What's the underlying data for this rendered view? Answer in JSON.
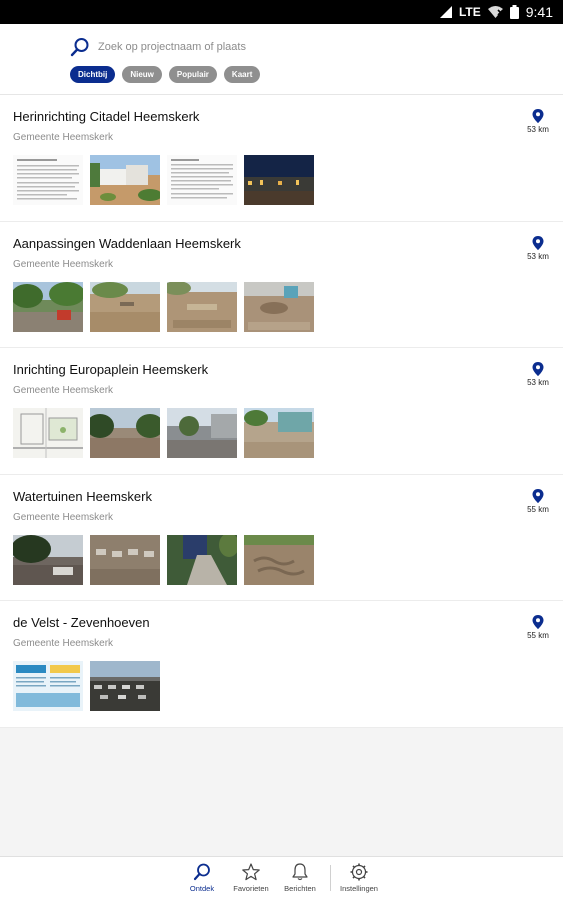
{
  "status_bar": {
    "network": "LTE",
    "time": "9:41"
  },
  "search": {
    "placeholder": "Zoek op projectnaam of plaats"
  },
  "filters": [
    {
      "label": "Dichtbij",
      "active": true
    },
    {
      "label": "Nieuw",
      "active": false
    },
    {
      "label": "Populair",
      "active": false
    },
    {
      "label": "Kaart",
      "active": false
    }
  ],
  "projects": [
    {
      "title": "Herinrichting Citadel Heemskerk",
      "subtitle": "Gemeente Heemskerk",
      "distance": "53 km",
      "thumbnails": [
        "document-thumbnail",
        "photo-thumbnail",
        "document-thumbnail",
        "photo-thumbnail"
      ]
    },
    {
      "title": "Aanpassingen Waddenlaan Heemskerk",
      "subtitle": "Gemeente Heemskerk",
      "distance": "53 km",
      "thumbnails": [
        "photo-thumbnail",
        "photo-thumbnail",
        "photo-thumbnail",
        "photo-thumbnail"
      ]
    },
    {
      "title": "Inrichting Europaplein Heemskerk",
      "subtitle": "Gemeente Heemskerk",
      "distance": "53 km",
      "thumbnails": [
        "map-thumbnail",
        "photo-thumbnail",
        "photo-thumbnail",
        "photo-thumbnail"
      ]
    },
    {
      "title": "Watertuinen Heemskerk",
      "subtitle": "Gemeente Heemskerk",
      "distance": "55 km",
      "thumbnails": [
        "photo-thumbnail",
        "photo-thumbnail",
        "photo-thumbnail",
        "photo-thumbnail"
      ]
    },
    {
      "title": "de Velst - Zevenhoeven",
      "subtitle": "Gemeente Heemskerk",
      "distance": "55 km",
      "thumbnails": [
        "document-thumbnail",
        "photo-thumbnail"
      ]
    }
  ],
  "tabs": [
    {
      "label": "Ontdek",
      "icon": "search-icon",
      "active": true
    },
    {
      "label": "Favorieten",
      "icon": "star-icon",
      "active": false
    },
    {
      "label": "Berichten",
      "icon": "bell-icon",
      "active": false
    },
    {
      "label": "Instellingen",
      "icon": "gear-icon",
      "active": false
    }
  ],
  "colors": {
    "accent": "#0b2d8f",
    "chip_inactive": "#8f8f8f",
    "pin": "#0b2d8f"
  }
}
